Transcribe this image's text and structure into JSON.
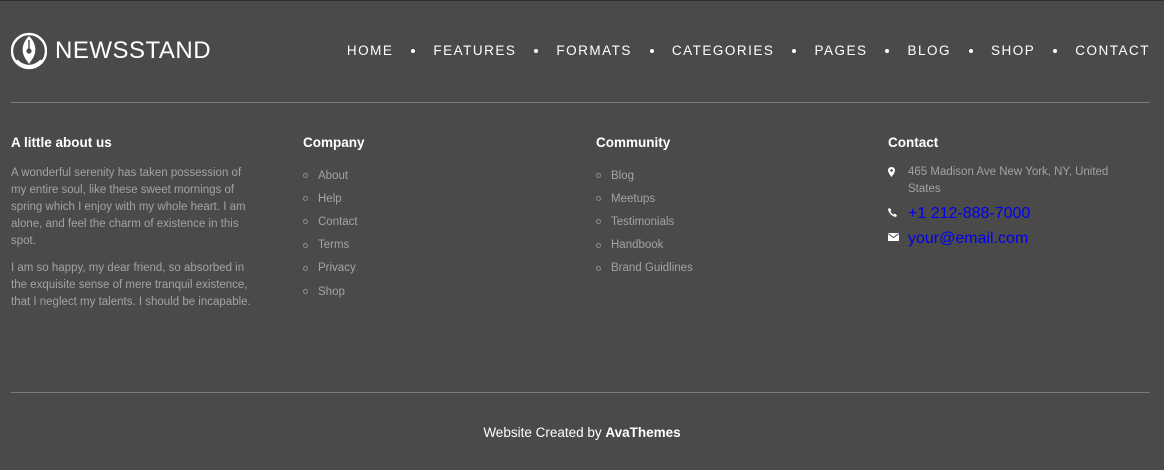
{
  "brand": {
    "name": "NEWSSTAND"
  },
  "nav": [
    {
      "label": "HOME"
    },
    {
      "label": "FEATURES"
    },
    {
      "label": "FORMATS"
    },
    {
      "label": "CATEGORIES"
    },
    {
      "label": "PAGES"
    },
    {
      "label": "BLOG"
    },
    {
      "label": "SHOP"
    },
    {
      "label": "CONTACT"
    }
  ],
  "about": {
    "title": "A little about us",
    "paragraphs": [
      "A wonderful serenity has taken possession of my entire soul, like these sweet mornings of spring which I enjoy with my whole heart. I am alone, and feel the charm of existence in this spot.",
      "I am so happy, my dear friend, so absorbed in the exquisite sense of mere tranquil existence, that I neglect my talents. I should be incapable."
    ]
  },
  "company": {
    "title": "Company",
    "links": [
      "About",
      "Help",
      "Contact",
      "Terms",
      "Privacy",
      "Shop"
    ]
  },
  "community": {
    "title": "Community",
    "links": [
      "Blog",
      "Meetups",
      "Testimonials",
      "Handbook",
      "Brand Guidlines"
    ]
  },
  "contact": {
    "title": "Contact",
    "items": [
      {
        "icon": "map-pin-icon",
        "text": "465 Madison Ave New York, NY, United States"
      },
      {
        "icon": "phone-icon",
        "text": "+1 212-888-7000"
      },
      {
        "icon": "envelope-icon",
        "text": "your@email.com"
      }
    ]
  },
  "credit": {
    "prefix": "Website Created by ",
    "author": "AvaThemes"
  },
  "colors": {
    "background": "#4a4a4a",
    "text": "#ffffff",
    "muted": "#a3a3a3",
    "rule": "#7a7a7a"
  }
}
